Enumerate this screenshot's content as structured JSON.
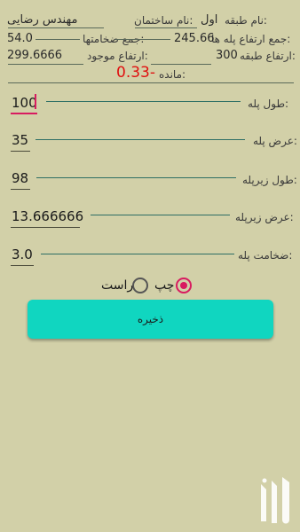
{
  "info": {
    "floor_name_label": "نام طبقه:",
    "floor_name_value": "اول",
    "building_name_label": "نام ساختمان:",
    "building_name_value": "مهندس رضایی",
    "sum_step_height_label": "جمع ارتفاع پله ها:",
    "sum_step_height_value": "245.66",
    "sum_thickness_label": "جمع ضخامتها:",
    "sum_thickness_value": "54.0",
    "floor_height_label": "ارتفاع طبقه:",
    "floor_height_value": "300",
    "existing_height_label": "ارتفاع موجود:",
    "existing_height_value": "299.6666",
    "remaining_label": "مانده:",
    "remaining_value": "0.33-"
  },
  "fields": {
    "stair_length": {
      "label": "طول پله:",
      "value": "100"
    },
    "stair_width": {
      "label": "عرض پله:",
      "value": "35"
    },
    "riser_length": {
      "label": "طول زیرپله:",
      "value": "98"
    },
    "riser_width": {
      "label": "عرض زیرپله:",
      "value": "13.666666"
    },
    "stair_thickness": {
      "label": "ضخامت پله:",
      "value": "3.0"
    }
  },
  "direction": {
    "left_label": "چپ",
    "right_label": "راست",
    "selected": "left"
  },
  "save_button": {
    "label": "ذخیره"
  },
  "colors": {
    "background": "#d2d0a8",
    "accent_pink": "#d81b60",
    "button_teal": "#10d6c0",
    "remaining_red": "#e01010"
  }
}
